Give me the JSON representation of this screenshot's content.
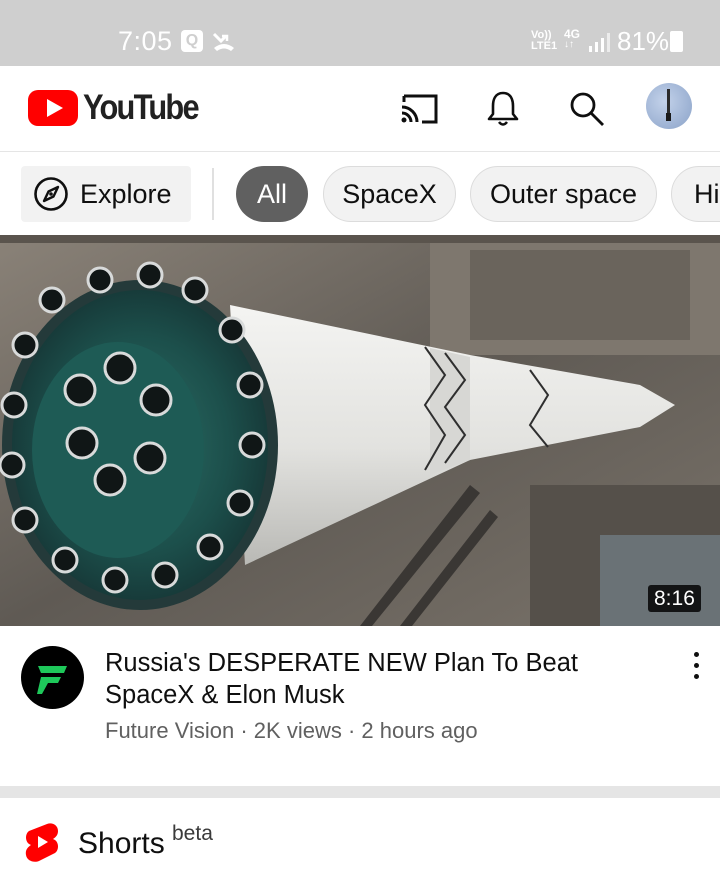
{
  "status_bar": {
    "time": "7:05",
    "notification_letter": "Q",
    "volte_top": "Vo))",
    "volte_bottom": "LTE1",
    "network": "4G",
    "battery_text": "81%",
    "battery_level": 0.81
  },
  "header": {
    "logo_text": "YouTube",
    "icons": [
      "cast-icon",
      "bell-icon",
      "search-icon",
      "account-avatar"
    ]
  },
  "chips": {
    "explore_label": "Explore",
    "items": [
      {
        "label": "All",
        "selected": true
      },
      {
        "label": "SpaceX",
        "selected": false
      },
      {
        "label": "Outer space",
        "selected": false
      },
      {
        "label": "Hi",
        "selected": false
      }
    ]
  },
  "video": {
    "duration": "8:16",
    "title": "Russia's DESPERATE NEW Plan To Beat SpaceX & Elon Musk",
    "channel": "Future Vision",
    "separator": "·",
    "views": "2K views",
    "age": "2 hours ago"
  },
  "shorts": {
    "title": "Shorts",
    "badge": "beta"
  },
  "colors": {
    "youtube_red": "#ff0000",
    "chip_selected_bg": "#606060",
    "chip_bg": "#f2f2f2",
    "secondary_text": "#606060",
    "status_bar_bg": "#cfcfcf",
    "channel_logo_green": "#1ec85a"
  }
}
